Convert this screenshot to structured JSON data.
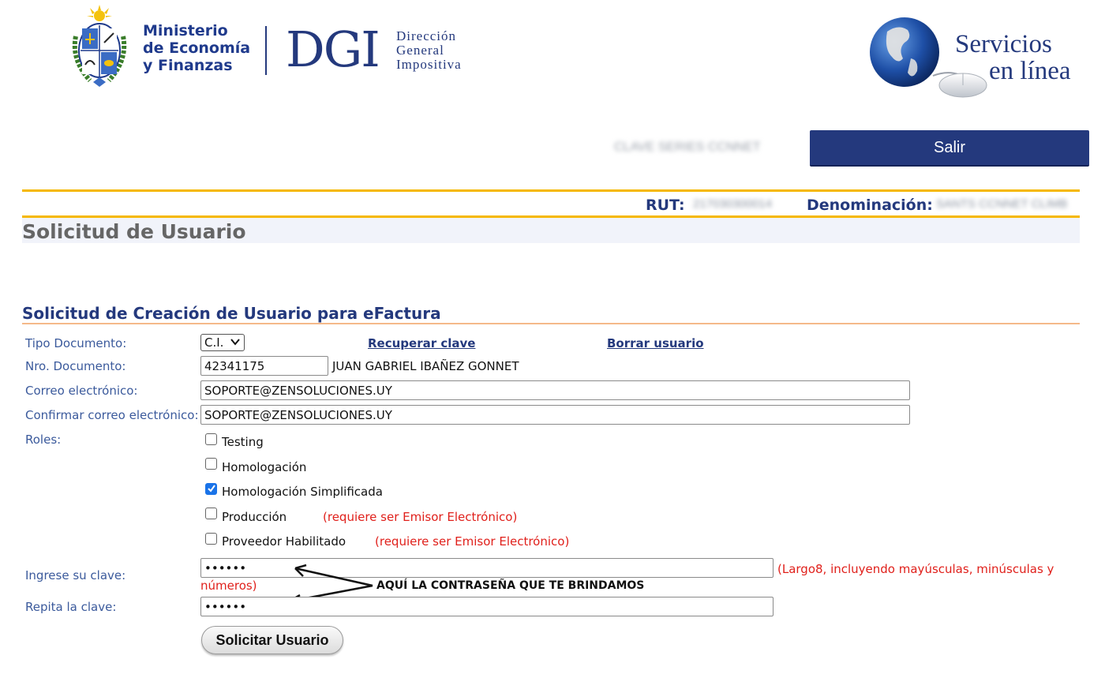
{
  "header": {
    "ministry_lines": [
      "Ministerio",
      "de Economía",
      "y Finanzas"
    ],
    "dgi_abbr": "DGI",
    "dgi_words": [
      "Dirección",
      "General",
      "Impositiva"
    ],
    "service_lines": [
      "Servicios",
      "en línea"
    ],
    "user_name": "CLAVE SERIES CCNNET",
    "logout_label": "Salir"
  },
  "info_bar": {
    "rut_label": "RUT:",
    "rut_value": "217030300014",
    "denomination_label": "Denominación:",
    "denomination_value": "SANTS CCNNET CLIMB"
  },
  "page_title": "Solicitud de Usuario",
  "section_title": "Solicitud de Creación de Usuario para eFactura",
  "form": {
    "doc_type_label": "Tipo Documento:",
    "doc_type_value": "C.I.",
    "recover_link": "Recuperar clave",
    "delete_link": "Borrar usuario",
    "doc_number_label": "Nro. Documento:",
    "doc_number_value": "42341175",
    "person_name": "JUAN GABRIEL IBAÑEZ GONNET",
    "email_label": "Correo electrónico:",
    "email_value": "SOPORTE@ZENSOLUCIONES.UY",
    "confirm_email_label": "Confirmar correo electrónico:",
    "confirm_email_value": "SOPORTE@ZENSOLUCIONES.UY",
    "roles_label": "Roles:",
    "roles": [
      {
        "label": "Testing",
        "checked": false,
        "note": ""
      },
      {
        "label": "Homologación",
        "checked": false,
        "note": ""
      },
      {
        "label": "Homologación Simplificada",
        "checked": true,
        "note": ""
      },
      {
        "label": "Producción",
        "checked": false,
        "note": "(requiere ser Emisor Electrónico)"
      },
      {
        "label": "Proveedor Habilitado",
        "checked": false,
        "note": "(requiere ser Emisor Electrónico)"
      }
    ],
    "password_label": "Ingrese su clave:",
    "password_value": "••••••",
    "password_hint_1": "(Largo8, incluyendo mayúsculas, minúsculas y",
    "password_hint_2": "números)",
    "repeat_password_label": "Repita la clave:",
    "repeat_password_value": "••••••",
    "annotation": "AQUÍ LA CONTRASEÑA QUE TE BRINDAMOS",
    "submit_label": "Solicitar Usuario"
  },
  "colors": {
    "brand_blue": "#24397d",
    "accent_gold": "#f5b800",
    "label_blue": "#3b5a9c",
    "warning_red": "#e0201b",
    "checkbox_blue": "#1a73e8"
  },
  "icons": {
    "shield": "uruguay-coat-of-arms-icon",
    "globe": "globe-mouse-icon",
    "select": "chevron-down-icon",
    "checkmark": "checkmark-icon",
    "arrow": "double-arrow-annotation-icon"
  }
}
